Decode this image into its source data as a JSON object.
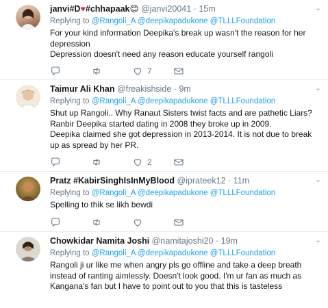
{
  "tweets": [
    {
      "name": "janvi#D",
      "name_suffix": "#chhapaak",
      "handle": "@janvi20041",
      "time": "15m",
      "replying_prefix": "Replying to",
      "mentions": "@Rangoli_A @deepikapadukone @TLLLFoundation",
      "text": [
        "For your kind information Deepika's break up wasn't the reason for her depression",
        "Depression doesn't need any reason educate yourself rangoli"
      ],
      "likes": "7",
      "icons": [
        "heart-emoji",
        "smile-emoji"
      ]
    },
    {
      "name": "Taimur Ali Khan",
      "handle": "@freakishside",
      "time": "9m",
      "replying_prefix": "Replying to",
      "mentions": "@Rangoli_A @deepikapadukone @TLLLFoundation",
      "text": [
        "Shut up Rangoli.. Why Ranaut Sisters twist facts and are pathetic Liars?",
        "Ranbir Deepika started dating in 2008 they broke up in 2009.",
        "Deepika claimed she got depression in 2013-2014. It is not due to break up as spread by her PR."
      ],
      "likes": "2"
    },
    {
      "name": "Pratz #KabirSinghIsInMyBlood",
      "handle": "@iprateek12",
      "time": "11m",
      "replying_prefix": "Replying to",
      "mentions": "@Rangoli_A @deepikapadukone @TLLLFoundation",
      "text": [
        "Spelling to thik se likh bewdi"
      ],
      "likes": ""
    },
    {
      "name": "Chowkidar Namita Joshi",
      "handle": "@namitajoshi20",
      "time": "19m",
      "replying_prefix": "Replying to",
      "mentions": "@Rangoli_A @deepikapadukone @TLLLFoundation",
      "text": [
        "Rangoli ji ur like me when angry pls go offline and take a deep breath instead of ranting aimlessly. Doesn't look good. I'm ur fan as much as Kangana's fan but I have to point out to you that this is tasteless"
      ],
      "likes": ""
    }
  ],
  "separator": "·",
  "colors": {
    "link": "#1da1f2",
    "muted": "#657786",
    "heart": "#e0245e",
    "border": "#e6ecf0"
  }
}
